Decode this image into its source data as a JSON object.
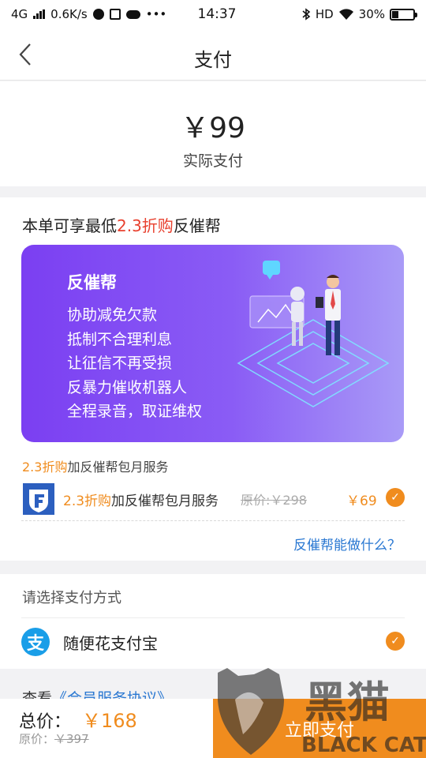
{
  "statusbar": {
    "network": "4G",
    "speed": "0.6K/s",
    "dots": "•••",
    "time": "14:37",
    "hd": "HD",
    "battery": "30%",
    "battery_level": 0.3
  },
  "nav": {
    "back_icon": "chevron-left-icon",
    "title": "支付"
  },
  "amount": {
    "value": "￥99",
    "label": "实际支付"
  },
  "promo": {
    "title_prefix": "本单可享最低",
    "title_highlight": "2.3折购",
    "title_suffix": "反催帮",
    "banner": {
      "title": "反催帮",
      "items": [
        "协助减免欠款",
        "抵制不合理利息",
        "让征信不再受损",
        "反暴力催收机器人",
        "全程录音，取证维权"
      ]
    },
    "service_line_highlight": "2.3折购",
    "service_line_text": "加反催帮包月服务",
    "row": {
      "highlight": "2.3折购",
      "text": "加反催帮包月服务",
      "original_price": "原价:￥298",
      "price": "￥69",
      "selected": true
    },
    "help_link": "反催帮能做什么？"
  },
  "payment": {
    "label": "请选择支付方式",
    "method": "随便花支付宝",
    "icon_char": "支",
    "selected": true
  },
  "agreement": {
    "prefix": "查看",
    "link": "《会员服务协议》"
  },
  "footer": {
    "total_label": "总价：",
    "total_price": "￥168",
    "original_label": "原价：",
    "original_price": "￥397",
    "pay_button": "立即支付"
  },
  "watermark": {
    "text_cn": "黑猫",
    "text_en": "BLACK CAT"
  },
  "colors": {
    "accent": "#f08c1e",
    "link": "#2a78d2",
    "red": "#e8402e",
    "banner_start": "#7b3ff2",
    "banner_end": "#a99bf7"
  }
}
